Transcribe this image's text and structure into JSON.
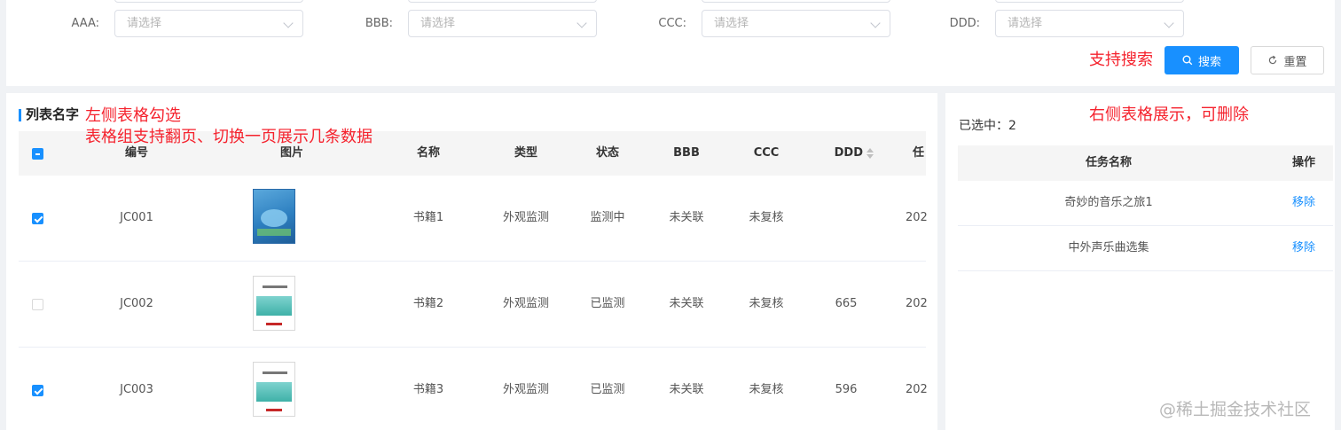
{
  "filters": [
    {
      "label": "AAA:",
      "placeholder": "请选择"
    },
    {
      "label": "BBB:",
      "placeholder": "请选择"
    },
    {
      "label": "CCC:",
      "placeholder": "请选择"
    },
    {
      "label": "DDD:",
      "placeholder": "请选择"
    }
  ],
  "notes": {
    "search": "支持搜索",
    "left_1": "左侧表格勾选",
    "left_2": "表格组支持翻页、切换一页展示几条数据",
    "right": "右侧表格展示，可删除"
  },
  "buttons": {
    "search": "搜索",
    "reset": "重置"
  },
  "left_table": {
    "title": "列表名字",
    "columns": [
      "编号",
      "图片",
      "名称",
      "类型",
      "状态",
      "BBB",
      "CCC",
      "DDD",
      "任"
    ],
    "rows": [
      {
        "checked": true,
        "id": "JC001",
        "cover": "blue",
        "name": "书籍1",
        "type": "外观监测",
        "status": "监测中",
        "bbb": "未关联",
        "ccc": "未复核",
        "ddd": "",
        "date": "202"
      },
      {
        "checked": false,
        "id": "JC002",
        "cover": "green",
        "name": "书籍2",
        "type": "外观监测",
        "status": "已监测",
        "bbb": "未关联",
        "ccc": "未复核",
        "ddd": "665",
        "date": "202"
      },
      {
        "checked": true,
        "id": "JC003",
        "cover": "green",
        "name": "书籍3",
        "type": "外观监测",
        "status": "已监测",
        "bbb": "未关联",
        "ccc": "未复核",
        "ddd": "596",
        "date": "202"
      }
    ]
  },
  "right_table": {
    "selected_label": "已选中：2",
    "columns": [
      "任务名称",
      "操作"
    ],
    "rows": [
      {
        "name": "奇妙的音乐之旅1",
        "action": "移除"
      },
      {
        "name": "中外声乐曲选集",
        "action": "移除"
      }
    ]
  },
  "colors": {
    "primary": "#1890ff",
    "note_red": "#f5222d",
    "header_bg": "#f5f5f5",
    "page_bg": "#f0f2f5"
  },
  "watermark": "@稀土掘金技术社区"
}
